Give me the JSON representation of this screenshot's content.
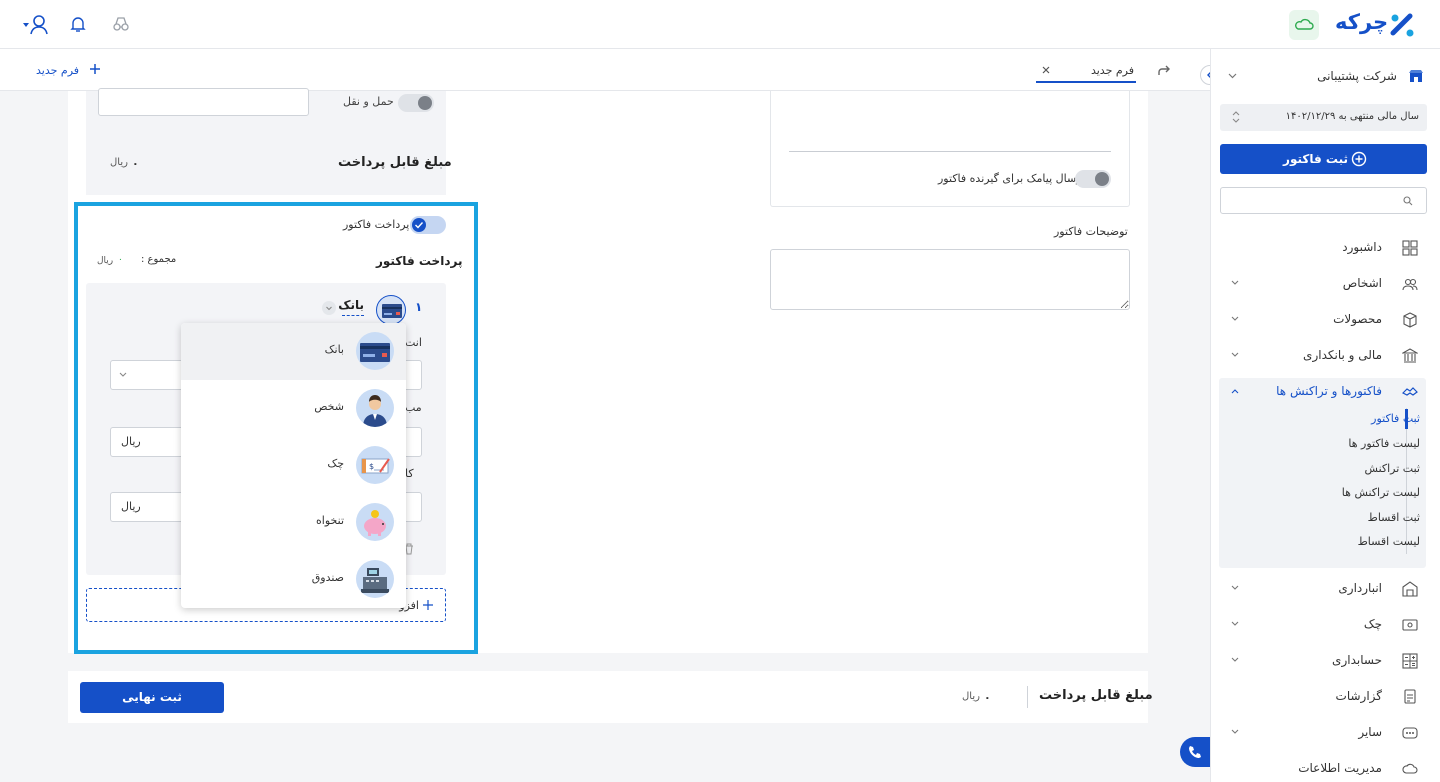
{
  "brand": {
    "name": "چرکه"
  },
  "tabs": {
    "active": "فرم جدید",
    "new_form": "فرم جدید"
  },
  "sidebar": {
    "company": "شرکت پشتیبانی",
    "fiscal_year": "سال مالی منتهی به ۱۴۰۲/۱۲/۲۹",
    "primary_button": "ثبت فاکتور",
    "search_placeholder": "",
    "items": [
      {
        "label": "داشبورد",
        "icon": "dashboard-icon",
        "chevron": false
      },
      {
        "label": "اشخاص",
        "icon": "people-icon",
        "chevron": true
      },
      {
        "label": "محصولات",
        "icon": "box-icon",
        "chevron": true
      },
      {
        "label": "مالی و بانکداری",
        "icon": "bank-icon",
        "chevron": true
      },
      {
        "label": "فاکتورها و تراکنش ها",
        "icon": "handshake-icon",
        "chevron": true,
        "active": true
      },
      {
        "label": "انبارداری",
        "icon": "warehouse-icon",
        "chevron": true
      },
      {
        "label": "چک",
        "icon": "cheque-icon",
        "chevron": true
      },
      {
        "label": "حسابداری",
        "icon": "calculator-icon",
        "chevron": true
      },
      {
        "label": "گزارشات",
        "icon": "report-icon",
        "chevron": false
      },
      {
        "label": "سایر",
        "icon": "more-icon",
        "chevron": true
      },
      {
        "label": "مدیریت اطلاعات",
        "icon": "cloud-settings-icon",
        "chevron": false
      }
    ],
    "submenu": [
      "ثبت فاکتور",
      "لیست فاکتور ها",
      "ثبت تراکنش",
      "لیست تراکنش ها",
      "ثبت اقساط",
      "لیست اقساط"
    ]
  },
  "form": {
    "shipping_label": "حمل و نقل",
    "payable_label": "مبلغ قابل پرداخت",
    "payable_value": "۰",
    "currency": "ریال",
    "sms_label": "ارسال پیامک برای گیرنده فاکتور",
    "notes_label": "توضیحات فاکتور",
    "payment_toggle_label": "پرداخت فاکتور",
    "payment_title": "پرداخت فاکتور",
    "total_label": "مجموع :",
    "total_value": "۰",
    "row_number": "۱",
    "method_selected": "بانک",
    "frag_1": "انت",
    "frag_2": "مب",
    "frag_3": "کا",
    "add_button": "افزو",
    "final_submit": "ثبت نهایی"
  },
  "dropdown": {
    "options": [
      "بانک",
      "شخص",
      "چک",
      "تنخواه",
      "صندوق"
    ]
  },
  "colors": {
    "primary": "#1550c8",
    "highlight": "#1aa3e0",
    "text": "#333333"
  }
}
